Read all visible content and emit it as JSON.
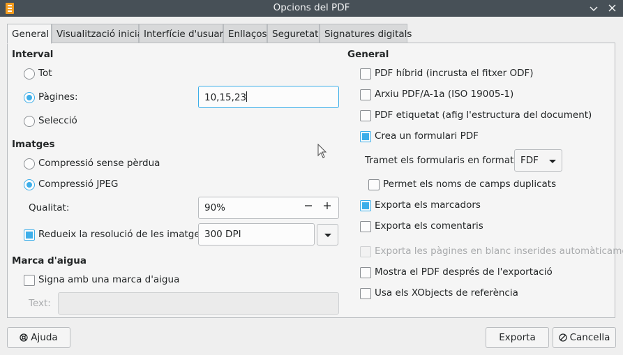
{
  "window": {
    "title": "Opcions del PDF",
    "minimize_icon": "chevron-down",
    "close_icon": "close"
  },
  "tabs": [
    {
      "label": "General",
      "active": true
    },
    {
      "label": "Visualització inicial"
    },
    {
      "label": "Interfície d'usuari"
    },
    {
      "label": "Enllaços"
    },
    {
      "label": "Seguretat"
    },
    {
      "label": "Signatures digitals"
    }
  ],
  "range": {
    "heading": "Interval",
    "all": "Tot",
    "pages": "Pàgines:",
    "pages_value": "10,15,23",
    "selection": "Selecció"
  },
  "images": {
    "heading": "Imatges",
    "lossless": "Compressió sense pèrdua",
    "jpeg": "Compressió JPEG",
    "quality_label": "Qualitat:",
    "quality_value": "90%",
    "minus": "—",
    "plus": "+",
    "reduce_label": "Redueix la resolució de les imatges",
    "dpi_value": "300 DPI"
  },
  "watermark": {
    "heading": "Marca d'aigua",
    "sign": "Signa amb una marca d'aigua",
    "text_label": "Text:",
    "text_value": ""
  },
  "general": {
    "heading": "General",
    "hybrid": "PDF híbrid (incrusta el fitxer ODF)",
    "archive": "Arxiu PDF/A-1a (ISO 19005-1)",
    "tagged": "PDF etiquetat (afig l'estructura del document)",
    "form": "Crea un formulari PDF",
    "submit_label": "Tramet els formularis en format:",
    "submit_value": "FDF",
    "duplicate": "Permet els noms de camps duplicats",
    "bookmarks": "Exporta els marcadors",
    "comments": "Exporta els comentaris",
    "blank_pages": "Exporta les pàgines en blanc inserides automàticament",
    "view_after": "Mostra el PDF després de l'exportació",
    "xobjects": "Usa els XObjects de referència"
  },
  "buttons": {
    "help": "Ajuda",
    "export": "Exporta",
    "cancel": "Cancella"
  },
  "colors": {
    "accent": "#3daee9",
    "titlebar": "#475057"
  }
}
